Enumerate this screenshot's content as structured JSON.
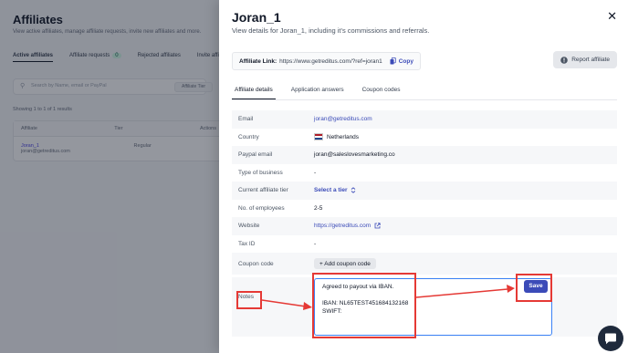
{
  "background": {
    "title": "Affiliates",
    "subtitle": "View active affiliates, manage affiliate requests, invite new affiliates and more.",
    "tabs": [
      {
        "label": "Active affiliates",
        "active": true
      },
      {
        "label": "Affiliate requests",
        "badge": "0"
      },
      {
        "label": "Rejected affiliates"
      },
      {
        "label": "Invite affiliates"
      }
    ],
    "search_placeholder": "Search by Name, email or PayPal",
    "filter_label": "Affiliate Tier",
    "count_text": "Showing 1 to 1 of 1 results",
    "table_headers": [
      "Affiliate",
      "Tier",
      "Actions"
    ],
    "table_rows": [
      {
        "name": "Joran_1",
        "email": "joran@getreditus.com",
        "tier": "Regular"
      }
    ]
  },
  "drawer": {
    "title": "Joran_1",
    "description": "View details for Joran_1, including it's commissions and referrals.",
    "affiliate_link_label": "Affiliate Link:",
    "affiliate_link_url": "https://www.getreditus.com/?ref=joran1",
    "copy_label": "Copy",
    "report_label": "Report affiliate",
    "tabs": [
      {
        "label": "Affiliate details",
        "active": true
      },
      {
        "label": "Application answers"
      },
      {
        "label": "Coupon codes"
      }
    ],
    "details": {
      "email_label": "Email",
      "email_value": "joran@getreditus.com",
      "country_label": "Country",
      "country_value": "Netherlands",
      "paypal_label": "Paypal email",
      "paypal_value": "joran@saleslovesmarketing.co",
      "business_label": "Type of business",
      "business_value": "-",
      "tier_label": "Current affiliate tier",
      "tier_value": "Select a tier",
      "employees_label": "No. of employees",
      "employees_value": "2-5",
      "website_label": "Website",
      "website_value": "https://getreditus.com",
      "taxid_label": "Tax ID",
      "taxid_value": "-",
      "coupon_label": "Coupon code",
      "coupon_button": "+ Add coupon code"
    },
    "notes_label": "Notes",
    "notes_lines": [
      "Agreed to payout via IBAN.",
      "",
      "IBAN: NL65TEST451684132168",
      "SWIFT:"
    ],
    "save_label": "Save"
  },
  "colors": {
    "accent": "#3b4bb8",
    "annotation": "#e53935",
    "focus_border": "#3b82f6"
  },
  "icons": [
    "close-icon",
    "copy-icon",
    "report-icon",
    "chevron-updown-icon",
    "external-link-icon",
    "netherlands-flag-icon",
    "chat-icon"
  ]
}
